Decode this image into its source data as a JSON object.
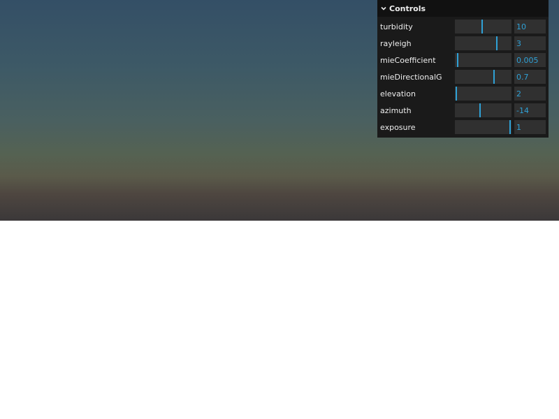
{
  "panel": {
    "title": "Controls",
    "accent_color": "#2fa1d6",
    "collapse_icon": "chevron-down-icon"
  },
  "controls": [
    {
      "label": "turbidity",
      "value": "10",
      "slider_fraction": 0.48
    },
    {
      "label": "rayleigh",
      "value": "3",
      "slider_fraction": 0.74
    },
    {
      "label": "mieCoefficient",
      "value": "0.005",
      "slider_fraction": 0.05
    },
    {
      "label": "mieDirectionalG",
      "value": "0.7",
      "slider_fraction": 0.69
    },
    {
      "label": "elevation",
      "value": "2",
      "slider_fraction": 0.02
    },
    {
      "label": "azimuth",
      "value": "-14",
      "slider_fraction": 0.44
    },
    {
      "label": "exposure",
      "value": "1",
      "slider_fraction": 0.98
    }
  ]
}
